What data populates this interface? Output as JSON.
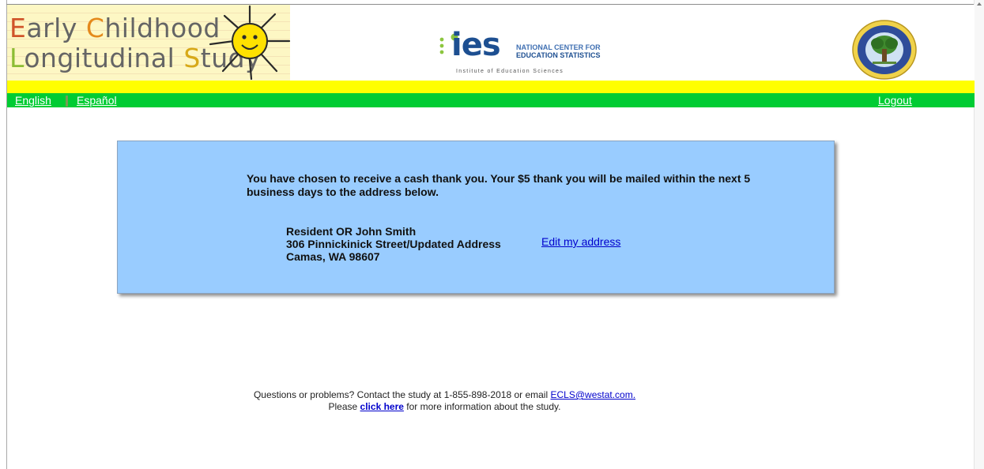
{
  "header": {
    "ecls_logo": {
      "line1": [
        "E",
        "arly ",
        "C",
        "hildhood"
      ],
      "line2": [
        "L",
        "ongitudinal ",
        "S",
        "tudy"
      ]
    },
    "ies_logo": {
      "wordmark": "ies",
      "name_line1": "NATIONAL CENTER FOR",
      "name_line2": "EDUCATION STATISTICS",
      "institute": "Institute of Education Sciences"
    },
    "seal_icon": "department-of-education-seal-icon"
  },
  "nav": {
    "english": "English",
    "espanol": "Español",
    "logout": "Logout"
  },
  "panel": {
    "message": "You have chosen to receive a cash thank you. Your $5 thank you will be mailed within the next 5 business days to the address below.",
    "address": {
      "line1": "Resident OR John Smith",
      "line2": "306 Pinnickinick Street/Updated Address",
      "line3": "Camas, WA 98607"
    },
    "edit_link": "Edit my address"
  },
  "footer": {
    "line1_text": "Questions or problems? Contact the study at 1-855-898-2018 or email",
    "email_link": "ECLS@westat.com.",
    "line2_pre": "Please",
    "click_here": "click here",
    "line2_post": "for more information about the study."
  },
  "colors": {
    "yellow_bar": "#ffff00",
    "green_bar": "#00cc33",
    "panel_bg": "#99ccff",
    "link": "#0000cc"
  }
}
